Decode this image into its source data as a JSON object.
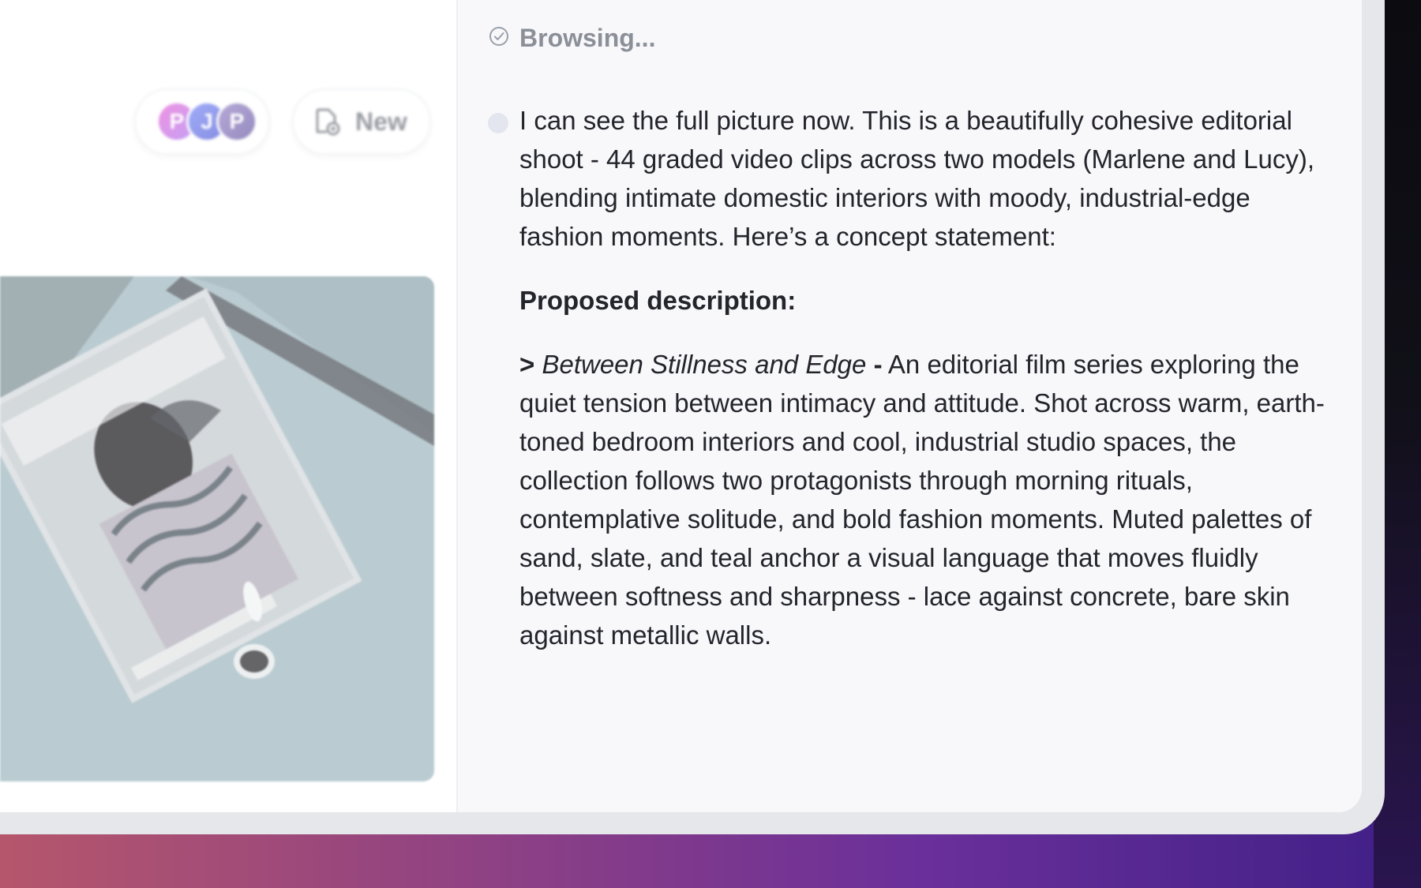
{
  "left_pane": {
    "collaborators": [
      "P",
      "J",
      "P"
    ],
    "new_button_label": "New"
  },
  "chat": {
    "status_text": "Browsing...",
    "message": {
      "intro": "I can see the full picture now. This is a beautifully cohesive editorial shoot - 44 graded video clips across two models (Marlene and Lucy), blending intimate domestic interiors with moody, industrial-edge fashion moments. Here’s a concept statement:",
      "heading": "Proposed description:",
      "quote_marker": ">",
      "quote_title": "Between Stillness and Edge",
      "quote_dash": "-",
      "quote_body": "An editorial film series exploring the quiet tension between intimacy and attitude. Shot across warm, earth-toned bedroom interiors and cool, industrial studio spaces, the collection follows two protagonists through morning rituals, contemplative solitude, and bold fashion moments. Muted palettes of sand, slate, and teal anchor a visual language that moves fluidly between softness and sharpness - lace against concrete, bare skin against metallic walls."
    }
  },
  "colors": {
    "accent_gradient": [
      "#b5566c",
      "#6a2f9a",
      "#3f1f86"
    ],
    "text_primary": "#23252b",
    "text_muted": "#8b8f98"
  }
}
